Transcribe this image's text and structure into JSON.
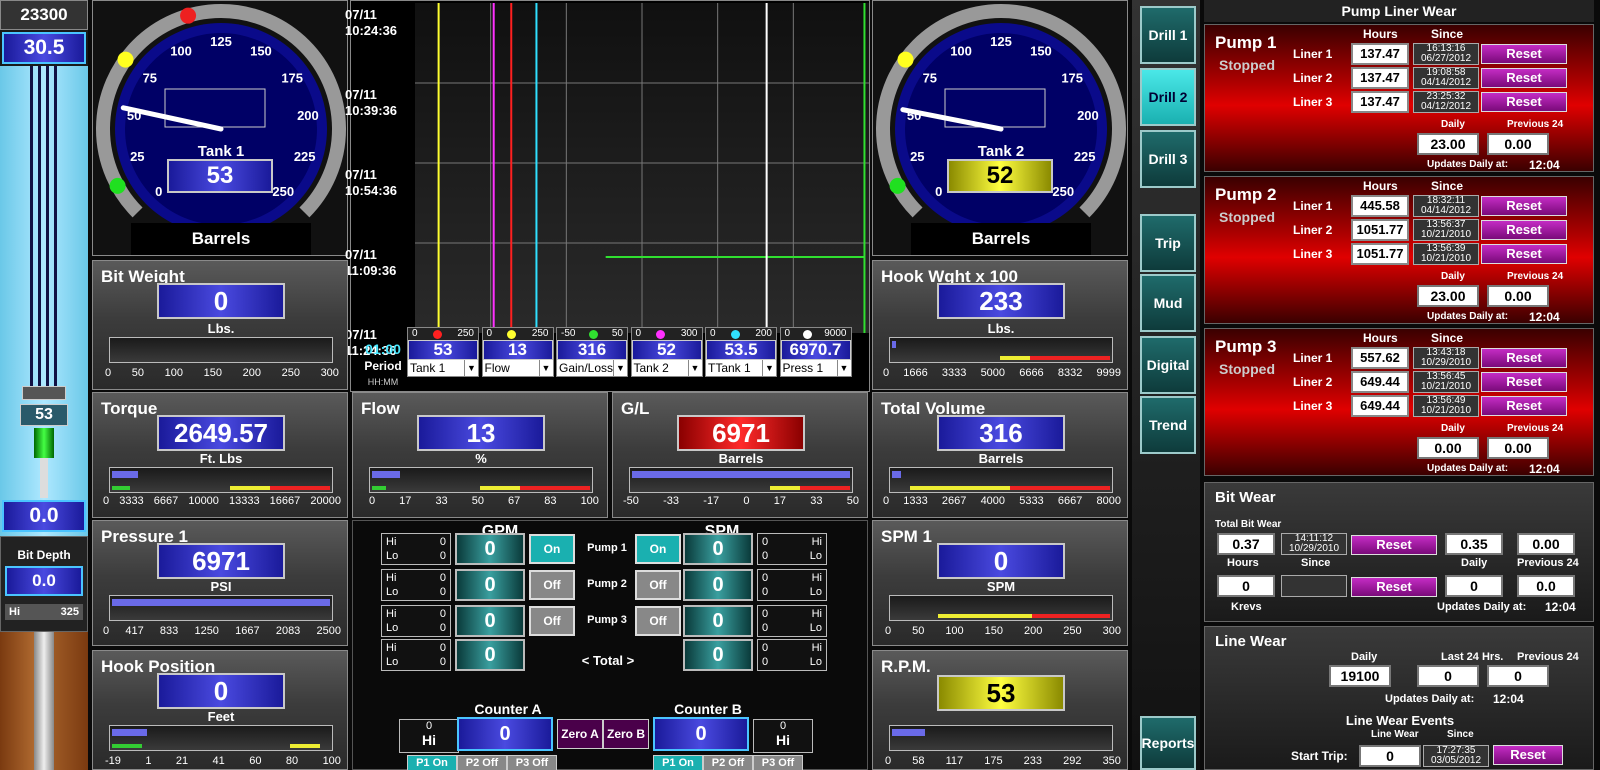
{
  "depth_column": {
    "top_value": "23300",
    "block_value": "30.5",
    "block_pos": "53",
    "bit_value": "0.0",
    "bit_depth_label": "Bit Depth",
    "bit_depth_value": "0.0",
    "hi_label": "Hi",
    "hi_value": "325"
  },
  "tanks": [
    {
      "label": "Tank 1",
      "value": "53",
      "unit": "Barrels",
      "ticks": [
        "0",
        "25",
        "50",
        "75",
        "100",
        "125",
        "150",
        "175",
        "200",
        "225",
        "250"
      ]
    },
    {
      "label": "Tank 2",
      "value": "52",
      "unit": "Barrels",
      "ticks": [
        "0",
        "25",
        "50",
        "75",
        "100",
        "125",
        "150",
        "175",
        "200",
        "225",
        "250"
      ]
    }
  ],
  "bit_weight": {
    "title": "Bit Weight",
    "value": "0",
    "unit": "Lbs.",
    "ticks": [
      "0",
      "50",
      "100",
      "150",
      "200",
      "250",
      "300"
    ],
    "level": 0
  },
  "hook_weight": {
    "title": "Hook Wght x 100",
    "value": "233",
    "unit": "Lbs.",
    "ticks": [
      "0",
      "1666",
      "3333",
      "5000",
      "6666",
      "8332",
      "9999"
    ],
    "level": 0.02
  },
  "torque": {
    "title": "Torque",
    "value": "2649.57",
    "unit": "Ft. Lbs",
    "ticks": [
      "0",
      "3333",
      "6667",
      "10000",
      "13333",
      "16667",
      "20000"
    ],
    "level": 0.12
  },
  "flow": {
    "title": "Flow",
    "value": "13",
    "unit": "%",
    "ticks": [
      "0",
      "17",
      "33",
      "50",
      "67",
      "83",
      "100"
    ],
    "level": 0.13
  },
  "gl": {
    "title": "G/L",
    "value": "6971",
    "unit": "Barrels",
    "ticks": [
      "-50",
      "-33",
      "-17",
      "0",
      "17",
      "33",
      "50"
    ],
    "level": 1
  },
  "total_volume": {
    "title": "Total Volume",
    "value": "316",
    "unit": "Barrels",
    "ticks": [
      "0",
      "1333",
      "2667",
      "4000",
      "5333",
      "6667",
      "8000"
    ],
    "level": 0.04
  },
  "pressure": {
    "title": "Pressure 1",
    "value": "6971",
    "unit": "PSI",
    "ticks": [
      "0",
      "417",
      "833",
      "1250",
      "1667",
      "2083",
      "2500"
    ],
    "level": 1
  },
  "spm1": {
    "title": "SPM 1",
    "value": "0",
    "unit": "SPM",
    "ticks": [
      "0",
      "50",
      "100",
      "150",
      "200",
      "250",
      "300"
    ],
    "level": 0
  },
  "hook_position": {
    "title": "Hook Position",
    "value": "0",
    "unit": "Feet",
    "ticks": [
      "-19",
      "1",
      "21",
      "41",
      "60",
      "80",
      "100"
    ],
    "level": 0.16
  },
  "rpm": {
    "title": "R.P.M.",
    "value": "53",
    "ticks": [
      "0",
      "58",
      "117",
      "175",
      "233",
      "292",
      "350"
    ],
    "level": 0.15
  },
  "chart": {
    "times": [
      "07/11\n10:24:36",
      "07/11\n10:39:36",
      "07/11\n10:54:36",
      "07/11\n11:09:36",
      "07/11\n11:24:36"
    ],
    "period_value": "01:00",
    "period_label": "Period",
    "period_fmt": "HH:MM",
    "traces": [
      {
        "min": "0",
        "max": "250",
        "value": "53",
        "select": "Tank 1",
        "color": "#ff2020"
      },
      {
        "min": "0",
        "max": "250",
        "value": "13",
        "select": "Flow",
        "color": "#ffff30"
      },
      {
        "min": "-50",
        "max": "50",
        "value": "316",
        "select": "Gain/Loss",
        "color": "#30e030"
      },
      {
        "min": "0",
        "max": "300",
        "value": "52",
        "select": "Tank 2",
        "color": "#ff30ff"
      },
      {
        "min": "0",
        "max": "200",
        "value": "53.5",
        "select": "TTank 1",
        "color": "#30e0ff"
      },
      {
        "min": "0",
        "max": "9000",
        "value": "6970.7",
        "select": "Press 1",
        "color": "#ffffff"
      }
    ]
  },
  "gpm_spm": {
    "gpm_title": "GPM",
    "spm_title": "SPM",
    "total_label": "<  Total  >",
    "rows": [
      {
        "pump": "Pump 1",
        "gpm": "0",
        "spm": "0",
        "gpm_state": "On",
        "spm_state": "On",
        "hi": "Hi",
        "lo": "Lo",
        "hi_v": "0",
        "lo_v": "0"
      },
      {
        "pump": "Pump 2",
        "gpm": "0",
        "spm": "0",
        "gpm_state": "Off",
        "spm_state": "Off",
        "hi": "Hi",
        "lo": "Lo",
        "hi_v": "0",
        "lo_v": "0"
      },
      {
        "pump": "Pump 3",
        "gpm": "0",
        "spm": "0",
        "gpm_state": "Off",
        "spm_state": "Off",
        "hi": "Hi",
        "lo": "Lo",
        "hi_v": "0",
        "lo_v": "0"
      },
      {
        "pump": "",
        "gpm": "0",
        "spm": "0",
        "hi": "Hi",
        "lo": "Lo",
        "hi_v": "0",
        "lo_v": "0"
      }
    ]
  },
  "counters": {
    "a_title": "Counter A",
    "b_title": "Counter B",
    "a_value": "0",
    "b_value": "0",
    "zero_a": "Zero A",
    "zero_b": "Zero B",
    "a_hi": "Hi",
    "a_hi_v": "0",
    "b_hi": "Hi",
    "b_hi_v": "0",
    "a_btns": [
      "P1 On",
      "P2 Off",
      "P3 Off"
    ],
    "b_btns": [
      "P1 On",
      "P2 Off",
      "P3 Off"
    ]
  },
  "nav": [
    "Drill 1",
    "Drill 2",
    "Drill 3",
    "Trip",
    "Mud",
    "Digital",
    "Trend",
    "Reports"
  ],
  "liner_wear": {
    "title": "Pump Liner Wear",
    "hours_label": "Hours",
    "since_label": "Since",
    "daily_label": "Daily",
    "prev_label": "Previous 24",
    "updates_label": "Updates Daily at:",
    "reset": "Reset",
    "pumps": [
      {
        "name": "Pump 1",
        "status": "Stopped",
        "update_time": "12:04",
        "daily": "23.00",
        "prev": "0.00",
        "liners": [
          {
            "label": "Liner 1",
            "hours": "137.47",
            "time": "16:13:16",
            "date": "06/27/2012"
          },
          {
            "label": "Liner 2",
            "hours": "137.47",
            "time": "19:08:58",
            "date": "04/14/2012"
          },
          {
            "label": "Liner 3",
            "hours": "137.47",
            "time": "23:25:32",
            "date": "04/12/2012"
          }
        ]
      },
      {
        "name": "Pump 2",
        "status": "Stopped",
        "update_time": "12:04",
        "daily": "23.00",
        "prev": "0.00",
        "liners": [
          {
            "label": "Liner 1",
            "hours": "445.58",
            "time": "18:32:11",
            "date": "04/14/2012"
          },
          {
            "label": "Liner 2",
            "hours": "1051.77",
            "time": "13:56:37",
            "date": "10/21/2010"
          },
          {
            "label": "Liner 3",
            "hours": "1051.77",
            "time": "13:56:39",
            "date": "10/21/2010"
          }
        ]
      },
      {
        "name": "Pump 3",
        "status": "Stopped",
        "update_time": "12:04",
        "daily": "0.00",
        "prev": "0.00",
        "liners": [
          {
            "label": "Liner 1",
            "hours": "557.62",
            "time": "13:43:18",
            "date": "10/29/2010"
          },
          {
            "label": "Liner 2",
            "hours": "649.44",
            "time": "13:56:45",
            "date": "10/21/2010"
          },
          {
            "label": "Liner 3",
            "hours": "649.44",
            "time": "13:56:49",
            "date": "10/21/2010"
          }
        ]
      }
    ]
  },
  "bit_wear": {
    "title": "Bit Wear",
    "total_label": "Total Bit Wear",
    "total": "0.37",
    "time": "14:11:12",
    "date": "10/29/2010",
    "daily": "0.35",
    "prev": "0.00",
    "hours_label": "Hours",
    "since_label": "Since",
    "daily_label": "Daily",
    "prev_label": "Previous 24",
    "krevs": "0",
    "krevs_label": "Krevs",
    "daily2": "0",
    "prev2": "0.0",
    "updates_label": "Updates Daily at:",
    "update_time": "12:04",
    "reset": "Reset"
  },
  "line_wear": {
    "title": "Line Wear",
    "daily_label": "Daily",
    "last24_label": "Last 24 Hrs.",
    "prev_label": "Previous 24",
    "daily": "19100",
    "last24": "0",
    "prev": "0",
    "updates_label": "Updates Daily at:",
    "update_time": "12:04"
  },
  "line_wear_events": {
    "title": "Line Wear Events",
    "line_wear_label": "Line Wear",
    "since_label": "Since",
    "start_trip_label": "Start Trip:",
    "start_trip": "0",
    "time": "17:27:35",
    "date": "03/05/2012",
    "reset": "Reset"
  }
}
